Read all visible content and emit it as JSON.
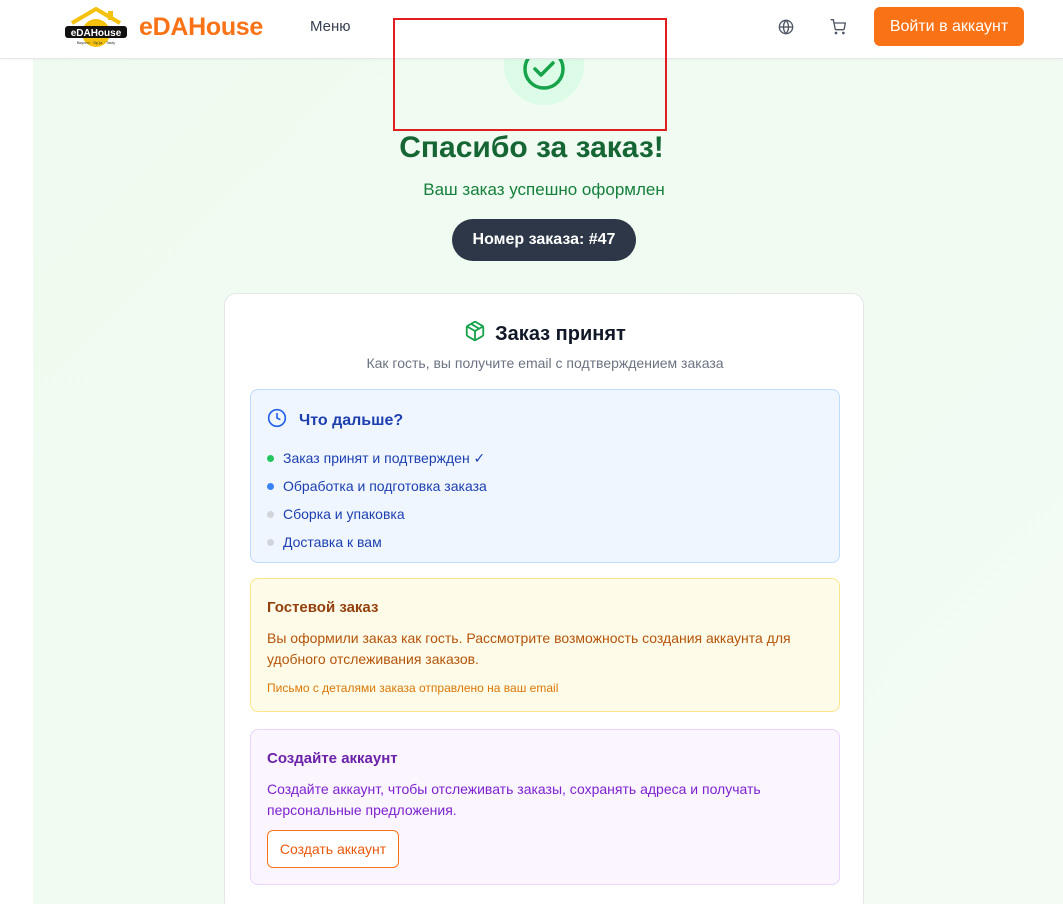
{
  "header": {
    "brand": "eDAHouse",
    "logo_text": "eDAHouse",
    "logo_tagline": "Вкусно · Sp.ja · Tasty",
    "menu_label": "Меню",
    "login_label": "Войти в аккаунт",
    "icons": [
      "globe-icon",
      "cart-icon"
    ]
  },
  "confirmation": {
    "title": "Спасибо за заказ!",
    "subtitle": "Ваш заказ успешно оформлен",
    "order_number": "Номер заказа: #47"
  },
  "card": {
    "title": "Заказ принят",
    "subtitle": "Как гость, вы получите email с подтверждением заказа",
    "next_steps": {
      "title": "Что дальше?",
      "items": [
        {
          "label": "Заказ принят и подтвержден ✓",
          "status_color": "#22c55e"
        },
        {
          "label": "Обработка и подготовка заказа",
          "status_color": "#3b82f6"
        },
        {
          "label": "Сборка и упаковка",
          "status_color": "#d1d5db"
        },
        {
          "label": "Доставка к вам",
          "status_color": "#d1d5db"
        }
      ]
    },
    "guest": {
      "title": "Гостевой заказ",
      "text": "Вы оформили заказ как гость. Рассмотрите возможность создания аккаунта для удобного отслеживания заказов.",
      "note": "Письмо с деталями заказа отправлено на ваш email"
    },
    "account": {
      "title": "Создайте аккаунт",
      "text": "Создайте аккаунт, чтобы отслеживать заказы, сохранять адреса и получать персональные предложения.",
      "button": "Создать аккаунт"
    }
  },
  "colors": {
    "accent": "#f97316",
    "success": "#16a34a",
    "badge_bg": "#2d3748"
  }
}
